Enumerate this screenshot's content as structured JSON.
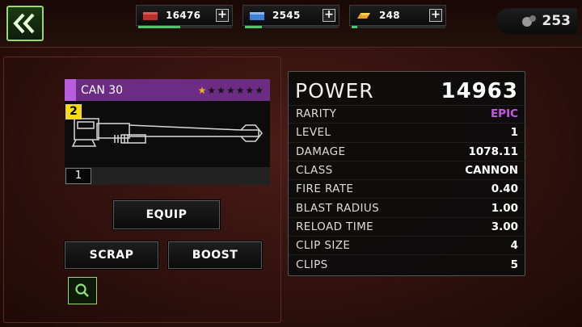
{
  "resources": [
    {
      "name": "brick",
      "value": "16476",
      "icon": "red-crate-icon",
      "color": "#b8322a",
      "fill": 0.45
    },
    {
      "name": "steel",
      "value": "2545",
      "icon": "blue-crate-icon",
      "color": "#3f7fd6",
      "fill": 0.18
    },
    {
      "name": "gold",
      "value": "248",
      "icon": "gold-bars-icon",
      "color": "#e9a21d",
      "fill": 0.06
    }
  ],
  "grenades": {
    "value": "253",
    "icon": "grenade-icon"
  },
  "weapon": {
    "name": "CAN 30",
    "level_badge": "2",
    "stars_filled": 1,
    "stars_total": 7,
    "count": "1",
    "rarity_color": "#b85de0"
  },
  "actions": {
    "equip": "EQUIP",
    "scrap": "SCRAP",
    "boost": "BOOST"
  },
  "stats": {
    "power_label": "POWER",
    "power_value": "14963",
    "rows": [
      {
        "label": "RARITY",
        "value": "EPIC"
      },
      {
        "label": "LEVEL",
        "value": "1"
      },
      {
        "label": "DAMAGE",
        "value": "1078.11"
      },
      {
        "label": "CLASS",
        "value": "CANNON"
      },
      {
        "label": "FIRE RATE",
        "value": "0.40"
      },
      {
        "label": "BLAST RADIUS",
        "value": "1.00"
      },
      {
        "label": "RELOAD TIME",
        "value": "3.00"
      },
      {
        "label": "CLIP SIZE",
        "value": "4"
      },
      {
        "label": "CLIPS",
        "value": "5"
      }
    ]
  }
}
